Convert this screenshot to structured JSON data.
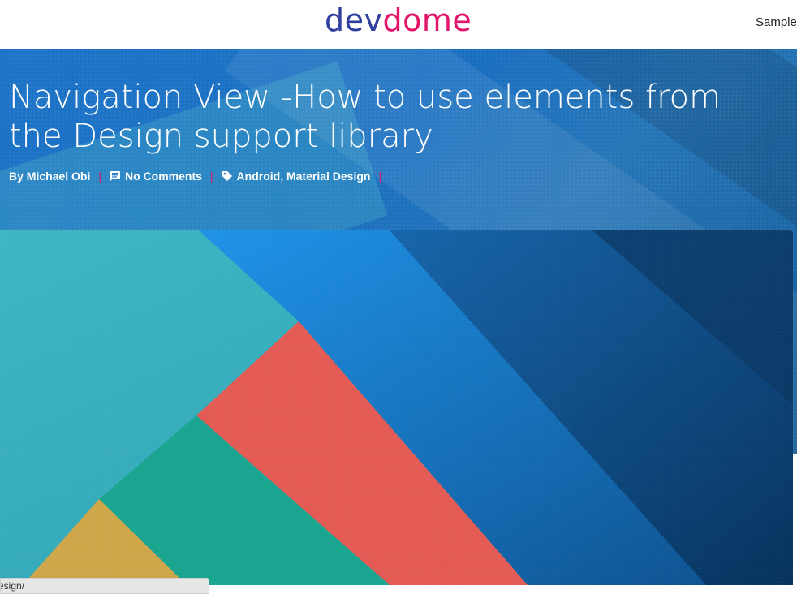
{
  "header": {
    "logo_part1": "dev",
    "logo_part2": "dome",
    "nav_link": "Sample"
  },
  "post": {
    "title": "Navigation View -How to use elements from the Design support library",
    "author_text": "By Michael Obi",
    "comments_text": "No Comments",
    "categories": [
      "Android",
      "Material Design"
    ],
    "category_separator": ", "
  },
  "status_bar": {
    "url_text": "esign/"
  },
  "colors": {
    "logo_dev": "#2e3f9e",
    "logo_dome": "#e3156b",
    "hero_blue": "#1d74c8",
    "separator": "#e3156b"
  },
  "icons": {
    "comments": "comment-icon",
    "categories": "tag-icon"
  }
}
